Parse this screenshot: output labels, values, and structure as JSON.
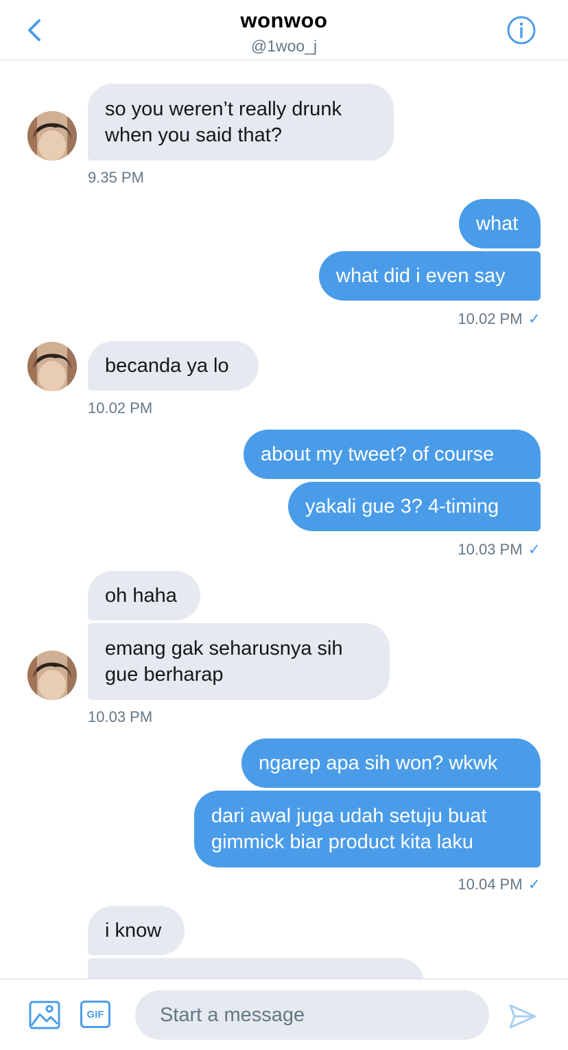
{
  "header": {
    "title": "wonwoo",
    "handle": "@1woo_j"
  },
  "messages": {
    "m1": {
      "line1": "so you weren’t really drunk",
      "line2": "when you said that?"
    },
    "t1": "9.35 PM",
    "m2": "what",
    "m3": "what did i even say",
    "t2": "10.02 PM",
    "m4": "becanda ya lo",
    "t3": "10.02 PM",
    "m5": "about my tweet? of course",
    "m6": "yakali gue 3? 4-timing",
    "t4": "10.03 PM",
    "m7": "oh haha",
    "m8": {
      "line1": "emang gak seharusnya sih",
      "line2": "gue berharap"
    },
    "t5": "10.03 PM",
    "m9": "ngarep apa sih won? wkwk",
    "m10": {
      "line1": "dari awal juga udah setuju buat",
      "line2": "gimmick biar product kita laku"
    },
    "t6": "10.04 PM",
    "m11": "i know"
  },
  "read_mark": "✓",
  "composer": {
    "placeholder": "Start a message",
    "gif_label": "GIF"
  },
  "colors": {
    "accent": "#4a9ce8",
    "received_bubble": "#e6e9ef",
    "muted_text": "#657786"
  }
}
